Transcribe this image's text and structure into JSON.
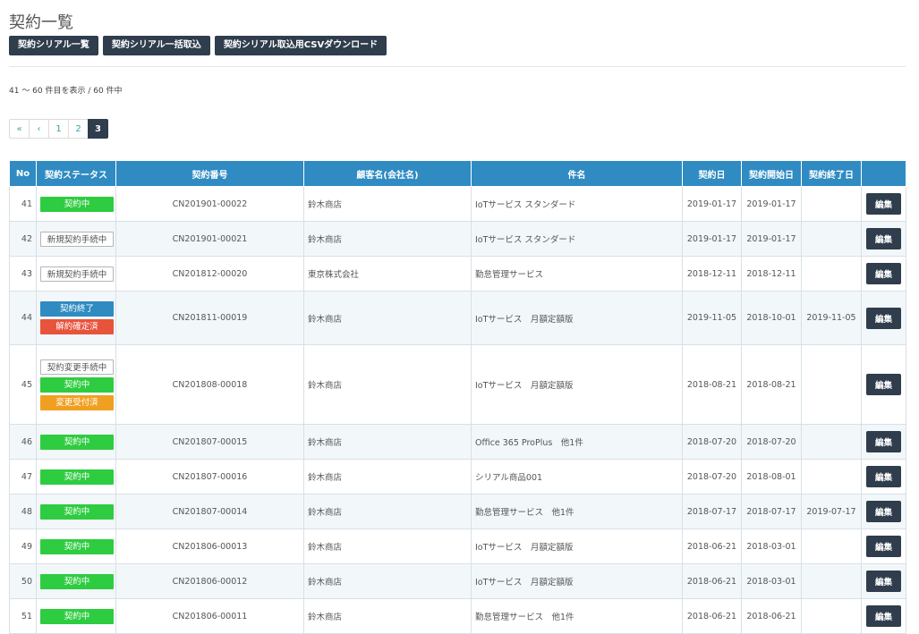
{
  "page": {
    "title": "契約一覧"
  },
  "toolbar": {
    "list_label": "契約シリアル一覧",
    "bulk_import_label": "契約シリアル一括取込",
    "csv_download_label": "契約シリアル取込用CSVダウンロード"
  },
  "summary": {
    "count_text": "41 〜 60 件目を表示 / 60 件中"
  },
  "pagination": {
    "first": "«",
    "prev": "‹",
    "pages": [
      "1",
      "2",
      "3"
    ],
    "current": "3"
  },
  "table": {
    "columns": [
      "No",
      "契約ステータス",
      "契約番号",
      "顧客名(会社名)",
      "件名",
      "契約日",
      "契約開始日",
      "契約終了日",
      ""
    ],
    "edit_label": "編集",
    "rows": [
      {
        "no": "41",
        "statuses": [
          {
            "label": "契約中",
            "color": "green"
          }
        ],
        "number": "CN201901-00022",
        "customer": "鈴木商店",
        "subject": "IoTサービス スタンダード",
        "contract_date": "2019-01-17",
        "start_date": "2019-01-17",
        "end_date": ""
      },
      {
        "no": "42",
        "statuses": [
          {
            "label": "新規契約手続中",
            "color": "white"
          }
        ],
        "number": "CN201901-00021",
        "customer": "鈴木商店",
        "subject": "IoTサービス スタンダード",
        "contract_date": "2019-01-17",
        "start_date": "2019-01-17",
        "end_date": ""
      },
      {
        "no": "43",
        "statuses": [
          {
            "label": "新規契約手続中",
            "color": "white"
          }
        ],
        "number": "CN201812-00020",
        "customer": "東京株式会社",
        "subject": "勤怠管理サービス",
        "contract_date": "2018-12-11",
        "start_date": "2018-12-11",
        "end_date": ""
      },
      {
        "no": "44",
        "statuses": [
          {
            "label": "契約終了",
            "color": "blue"
          },
          {
            "label": "解約確定済",
            "color": "red"
          }
        ],
        "number": "CN201811-00019",
        "customer": "鈴木商店",
        "subject": "IoTサービス　月額定額版",
        "contract_date": "2019-11-05",
        "start_date": "2018-10-01",
        "end_date": "2019-11-05"
      },
      {
        "no": "45",
        "statuses": [
          {
            "label": "契約変更手続中",
            "color": "white"
          },
          {
            "label": "契約中",
            "color": "green"
          },
          {
            "label": "変更受付済",
            "color": "orange"
          }
        ],
        "number": "CN201808-00018",
        "customer": "鈴木商店",
        "subject": "IoTサービス　月額定額版",
        "contract_date": "2018-08-21",
        "start_date": "2018-08-21",
        "end_date": ""
      },
      {
        "no": "46",
        "statuses": [
          {
            "label": "契約中",
            "color": "green"
          }
        ],
        "number": "CN201807-00015",
        "customer": "鈴木商店",
        "subject": "Office 365 ProPlus　他1件",
        "contract_date": "2018-07-20",
        "start_date": "2018-07-20",
        "end_date": ""
      },
      {
        "no": "47",
        "statuses": [
          {
            "label": "契約中",
            "color": "green"
          }
        ],
        "number": "CN201807-00016",
        "customer": "鈴木商店",
        "subject": "シリアル商品001",
        "contract_date": "2018-07-20",
        "start_date": "2018-08-01",
        "end_date": ""
      },
      {
        "no": "48",
        "statuses": [
          {
            "label": "契約中",
            "color": "green"
          }
        ],
        "number": "CN201807-00014",
        "customer": "鈴木商店",
        "subject": "勤怠管理サービス　他1件",
        "contract_date": "2018-07-17",
        "start_date": "2018-07-17",
        "end_date": "2019-07-17"
      },
      {
        "no": "49",
        "statuses": [
          {
            "label": "契約中",
            "color": "green"
          }
        ],
        "number": "CN201806-00013",
        "customer": "鈴木商店",
        "subject": "IoTサービス　月額定額版",
        "contract_date": "2018-06-21",
        "start_date": "2018-03-01",
        "end_date": ""
      },
      {
        "no": "50",
        "statuses": [
          {
            "label": "契約中",
            "color": "green"
          }
        ],
        "number": "CN201806-00012",
        "customer": "鈴木商店",
        "subject": "IoTサービス　月額定額版",
        "contract_date": "2018-06-21",
        "start_date": "2018-03-01",
        "end_date": ""
      },
      {
        "no": "51",
        "statuses": [
          {
            "label": "契約中",
            "color": "green"
          }
        ],
        "number": "CN201806-00011",
        "customer": "鈴木商店",
        "subject": "勤怠管理サービス　他1件",
        "contract_date": "2018-06-21",
        "start_date": "2018-06-21",
        "end_date": ""
      }
    ]
  },
  "colors": {
    "header_bg": "#2f8bc2",
    "dark_button": "#2f3d4d",
    "status_green": "#2ecc40",
    "status_blue": "#2f8bc2",
    "status_red": "#e8533c",
    "status_orange": "#f0a020",
    "pager_link": "#3aa3a3"
  }
}
